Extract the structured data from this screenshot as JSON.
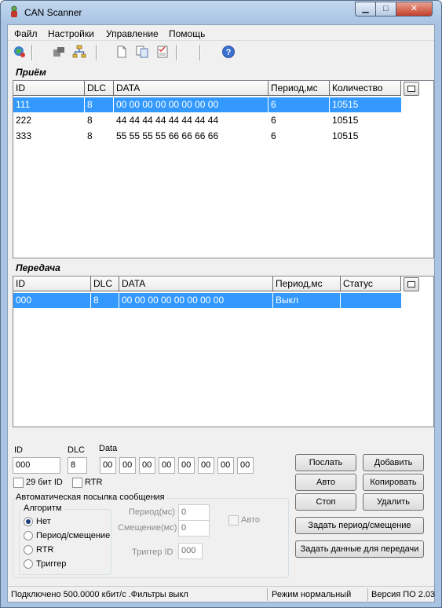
{
  "window": {
    "title": "CAN Scanner",
    "min": "▁",
    "max": "□",
    "close": "✕"
  },
  "menu": [
    "Файл",
    "Настройки",
    "Управление",
    "Помощь"
  ],
  "receive": {
    "label": "Приём",
    "headers": [
      "ID",
      "DLC",
      "DATA",
      "Период,мс",
      "Количество"
    ],
    "rows": [
      [
        "111",
        "8",
        "00 00 00 00 00 00 00 00",
        "6",
        "10515"
      ],
      [
        "222",
        "8",
        "44 44 44 44 44 44 44 44",
        "6",
        "10515"
      ],
      [
        "333",
        "8",
        "55 55 55 55 66 66 66 66",
        "6",
        "10515"
      ]
    ]
  },
  "transmit": {
    "label": "Передача",
    "headers": [
      "ID",
      "DLC",
      "DATA",
      "Период,мс",
      "Статус"
    ],
    "rows": [
      [
        "000",
        "8",
        "00 00 00 00 00 00 00 00",
        "Выкл",
        ""
      ]
    ]
  },
  "form": {
    "id_label": "ID",
    "dlc_label": "DLC",
    "data_label": "Data",
    "id_value": "000",
    "dlc_value": "8",
    "data_bytes": [
      "00",
      "00",
      "00",
      "00",
      "00",
      "00",
      "00",
      "00"
    ],
    "ext_id_label": "29 бит ID",
    "rtr_label": "RTR",
    "auto_group": "Автоматическая посылка сообщения",
    "algo_group": "Алгоритм",
    "algo_options": [
      "Нет",
      "Период/смещение",
      "RTR",
      "Триггер"
    ],
    "period_label": "Период(мс)",
    "period_value": "0",
    "offset_label": "Смещение(мс)",
    "offset_value": "0",
    "auto_label": "Авто",
    "trigger_label": "Триггер ID",
    "trigger_value": "000"
  },
  "buttons": {
    "send": "Послать",
    "add": "Добавить",
    "auto": "Авто",
    "copy": "Копировать",
    "stop": "Стоп",
    "delete": "Удалить",
    "set_period": "Задать период/смещение",
    "set_data": "Задать данные для передачи"
  },
  "status": {
    "connection": "Подключено 500.0000 кбит/с  .Фильтры выкл",
    "mode": "Режим нормальный",
    "version": "Версия ПО 2.03"
  },
  "colors": {
    "selection": "#3399ff",
    "accent": "#a9c4e3"
  }
}
